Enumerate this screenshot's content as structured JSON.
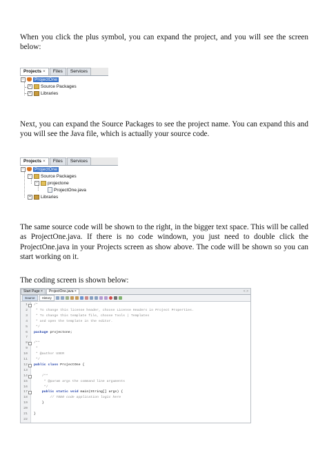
{
  "paragraphs": {
    "p1": "When you click the plus symbol, you can expand the project, and you will see the screen below:",
    "p2": "Next, you can expand the Source Packages to see the project name. You can expand this and you will see the Java file, which is actually your source code.",
    "p3": "The same source code will be shown to the right, in the bigger text space. This will be called as ProjectOne.java. If there is no code windown, you just need to double click the ProjectOne.java in your Projects screen as show above. The code will be shown so you can start working on it.",
    "p4": "The coding screen is shown below:"
  },
  "panel1": {
    "tabs": [
      "Projects",
      "Files",
      "Services"
    ],
    "close_glyph": "×",
    "items": [
      "ProjectOne",
      "Source Packages",
      "Libraries"
    ]
  },
  "panel2": {
    "tabs": [
      "Projects",
      "Files",
      "Services"
    ],
    "close_glyph": "×",
    "items": [
      "ProjectOne",
      "Source Packages",
      "projectone",
      "ProjectOne.java",
      "Libraries"
    ]
  },
  "editor": {
    "tabs": [
      "Start Page",
      "ProjectOne.java"
    ],
    "toolbar": {
      "source": "Source",
      "history": "History"
    },
    "lines": [
      "/*",
      " * To change this license header, choose License Headers in Project Properties.",
      " * To change this template file, choose Tools | Templates",
      " * and open the template in the editor.",
      " */",
      "package projectone;",
      "",
      "/**",
      " *",
      " * @author USER",
      " */",
      "public class ProjectOne {",
      "",
      "    /**",
      "     * @param args the command line arguments",
      "     */",
      "    public static void main(String[] args) {",
      "        // TODO code application logic here",
      "    }",
      "",
      "}",
      ""
    ]
  }
}
